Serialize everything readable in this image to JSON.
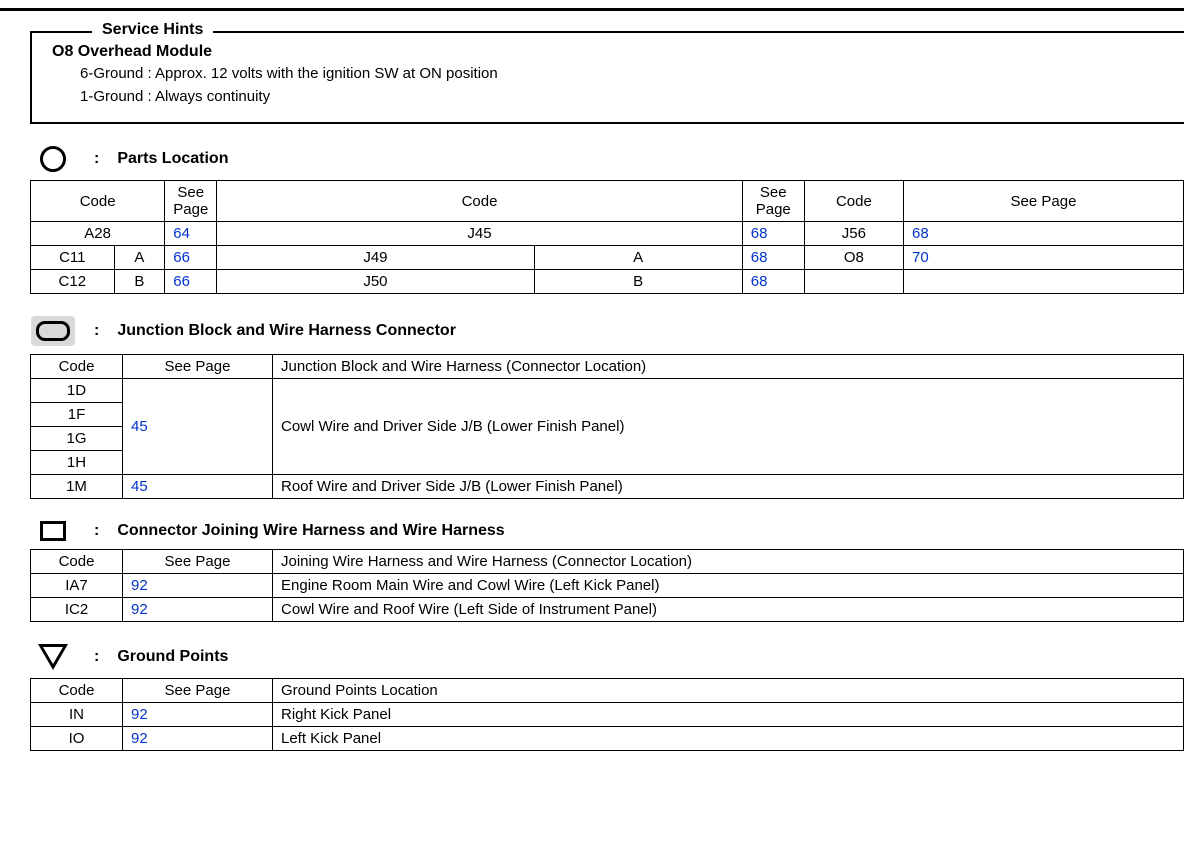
{
  "hints": {
    "legend": "Service Hints",
    "title": "O8  Overhead Module",
    "lines": [
      "6-Ground  :  Approx. 12 volts with the ignition SW at ON position",
      "1-Ground  :  Always continuity"
    ]
  },
  "parts_location": {
    "title": "Parts Location",
    "headers": {
      "code": "Code",
      "see": "See Page"
    },
    "rows": [
      {
        "c1": "A28",
        "s1": "",
        "p1": "64",
        "c2": "J45",
        "s2": "",
        "p2": "68",
        "c3": "J56",
        "s3": "",
        "p3": "68"
      },
      {
        "c1": "C11",
        "s1": "A",
        "p1": "66",
        "c2": "J49",
        "s2": "A",
        "p2": "68",
        "c3": "O8",
        "s3": "",
        "p3": "70"
      },
      {
        "c1": "C12",
        "s1": "B",
        "p1": "66",
        "c2": "J50",
        "s2": "B",
        "p2": "68",
        "c3": "",
        "s3": "",
        "p3": ""
      }
    ]
  },
  "junction_block": {
    "title": "Junction Block and Wire Harness Connector",
    "headers": {
      "code": "Code",
      "see": "See Page",
      "desc": "Junction Block and Wire Harness (Connector Location)"
    },
    "group_codes": [
      "1D",
      "1F",
      "1G",
      "1H"
    ],
    "group_page": "45",
    "group_desc": "Cowl Wire and Driver Side J/B (Lower Finish Panel)",
    "last": {
      "code": "1M",
      "page": "45",
      "desc": "Roof Wire and Driver Side J/B (Lower Finish Panel)"
    }
  },
  "connector_joining": {
    "title": "Connector Joining Wire Harness and Wire Harness",
    "headers": {
      "code": "Code",
      "see": "See Page",
      "desc": "Joining Wire Harness and Wire Harness (Connector Location)"
    },
    "rows": [
      {
        "code": "IA7",
        "page": "92",
        "desc": "Engine Room Main Wire and Cowl Wire (Left Kick Panel)"
      },
      {
        "code": "IC2",
        "page": "92",
        "desc": "Cowl Wire and Roof Wire (Left Side of Instrument Panel)"
      }
    ]
  },
  "ground_points": {
    "title": "Ground Points",
    "headers": {
      "code": "Code",
      "see": "See Page",
      "desc": "Ground Points Location"
    },
    "rows": [
      {
        "code": "IN",
        "page": "92",
        "desc": "Right Kick Panel"
      },
      {
        "code": "IO",
        "page": "92",
        "desc": "Left Kick Panel"
      }
    ]
  },
  "colon": ":"
}
